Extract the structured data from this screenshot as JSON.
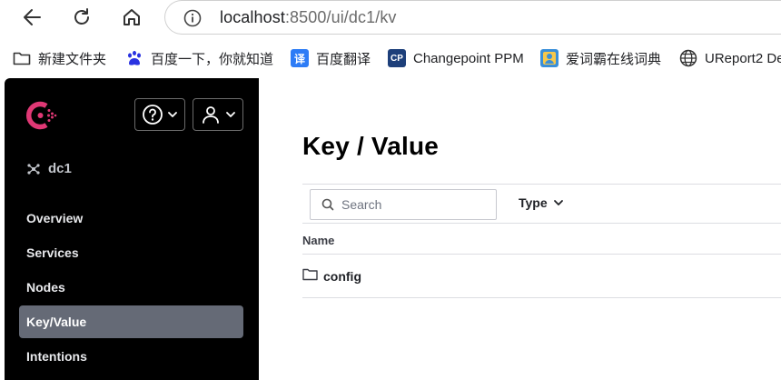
{
  "browser": {
    "url_host": "localhost",
    "url_rest": ":8500/ui/dc1/kv"
  },
  "bookmarks": [
    {
      "label": "新建文件夹",
      "icon": "folder-icon"
    },
    {
      "label": "百度一下，你就知道",
      "icon": "baidu-icon"
    },
    {
      "label": "百度翻译",
      "icon": "baidu-translate-icon",
      "glyph": "译"
    },
    {
      "label": "Changepoint PPM",
      "icon": "changepoint-icon",
      "glyph": "CP"
    },
    {
      "label": "爱词霸在线词典",
      "icon": "iciba-icon"
    },
    {
      "label": "UReport2 De",
      "icon": "globe-icon"
    }
  ],
  "sidebar": {
    "datacenter": "dc1",
    "items": [
      {
        "label": "Overview",
        "active": false
      },
      {
        "label": "Services",
        "active": false
      },
      {
        "label": "Nodes",
        "active": false
      },
      {
        "label": "Key/Value",
        "active": true
      },
      {
        "label": "Intentions",
        "active": false
      }
    ]
  },
  "main": {
    "title": "Key / Value",
    "search_placeholder": "Search",
    "type_label": "Type",
    "column_name": "Name",
    "rows": [
      {
        "name": "config",
        "icon": "folder-icon"
      }
    ]
  },
  "colors": {
    "sidebar_bg": "#000000",
    "active_item_bg": "#656a76",
    "brand_pink": "#e03875"
  }
}
